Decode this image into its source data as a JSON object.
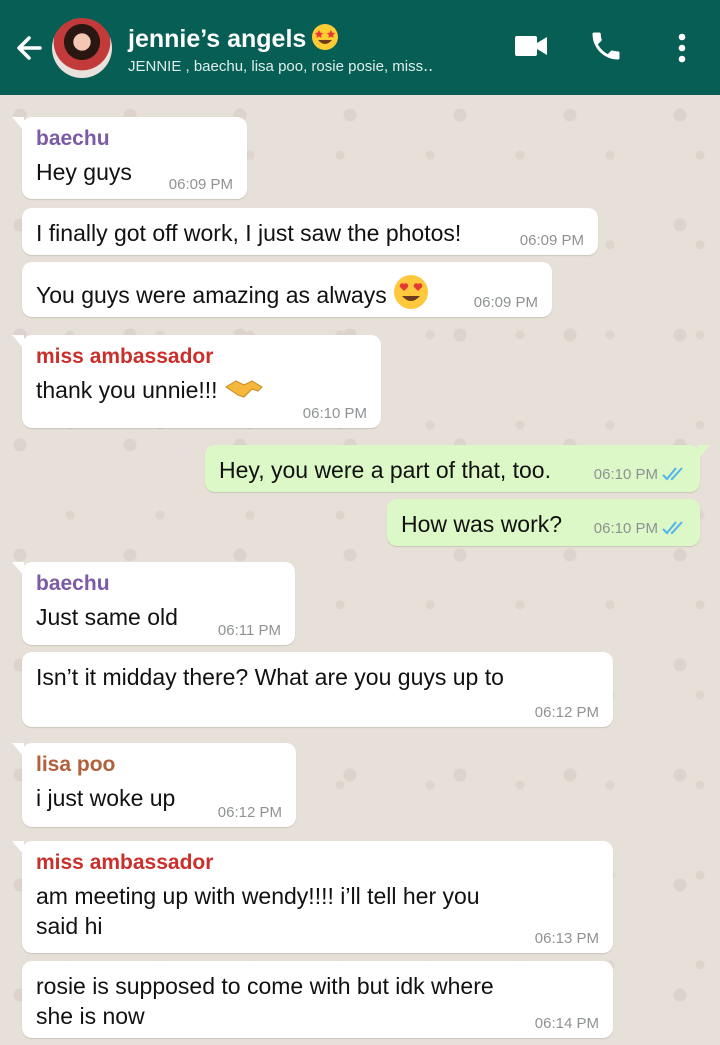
{
  "header": {
    "title": "jennie’s angels",
    "subtitle": "JENNIE , baechu, lisa poo, rosie posie, miss‥",
    "accent": "#075e54",
    "icons": [
      "back-arrow-icon",
      "video-call-icon",
      "voice-call-icon",
      "more-options-icon"
    ]
  },
  "messages": [
    {
      "sender": "baechu",
      "sender_color": "#7b5aa6",
      "text": "Hey guys",
      "time": "06:09 PM",
      "direction": "in"
    },
    {
      "text": "I finally got off work, I just saw the photos!",
      "time": "06:09 PM",
      "direction": "in"
    },
    {
      "text": "You guys were amazing as always",
      "emoji": "heart-eyes-emoji",
      "time": "06:09 PM",
      "direction": "in"
    },
    {
      "sender": "miss ambassador",
      "sender_color": "#c9302c",
      "text": "thank you unnie!!!",
      "emoji": "handshake-emoji",
      "time": "06:10 PM",
      "direction": "in"
    },
    {
      "text": "Hey, you were a part of that, too.",
      "time": "06:10 PM",
      "direction": "out"
    },
    {
      "text": "How was work?",
      "time": "06:10 PM",
      "direction": "out"
    },
    {
      "sender": "baechu",
      "sender_color": "#7b5aa6",
      "text": "Just same old",
      "time": "06:11 PM",
      "direction": "in"
    },
    {
      "text": "Isn’t it midday there? What are you guys up to",
      "time": "06:12 PM",
      "direction": "in"
    },
    {
      "sender": "lisa poo",
      "sender_color": "#b0603a",
      "text": "i just woke up",
      "time": "06:12 PM",
      "direction": "in"
    },
    {
      "sender": "miss ambassador",
      "sender_color": "#c9302c",
      "text": "am meeting up with wendy!!!! i’ll tell her you said hi",
      "time": "06:13 PM",
      "direction": "in"
    },
    {
      "text": "rosie is supposed to come with but idk where she is now",
      "time": "06:14 PM",
      "direction": "in"
    }
  ]
}
